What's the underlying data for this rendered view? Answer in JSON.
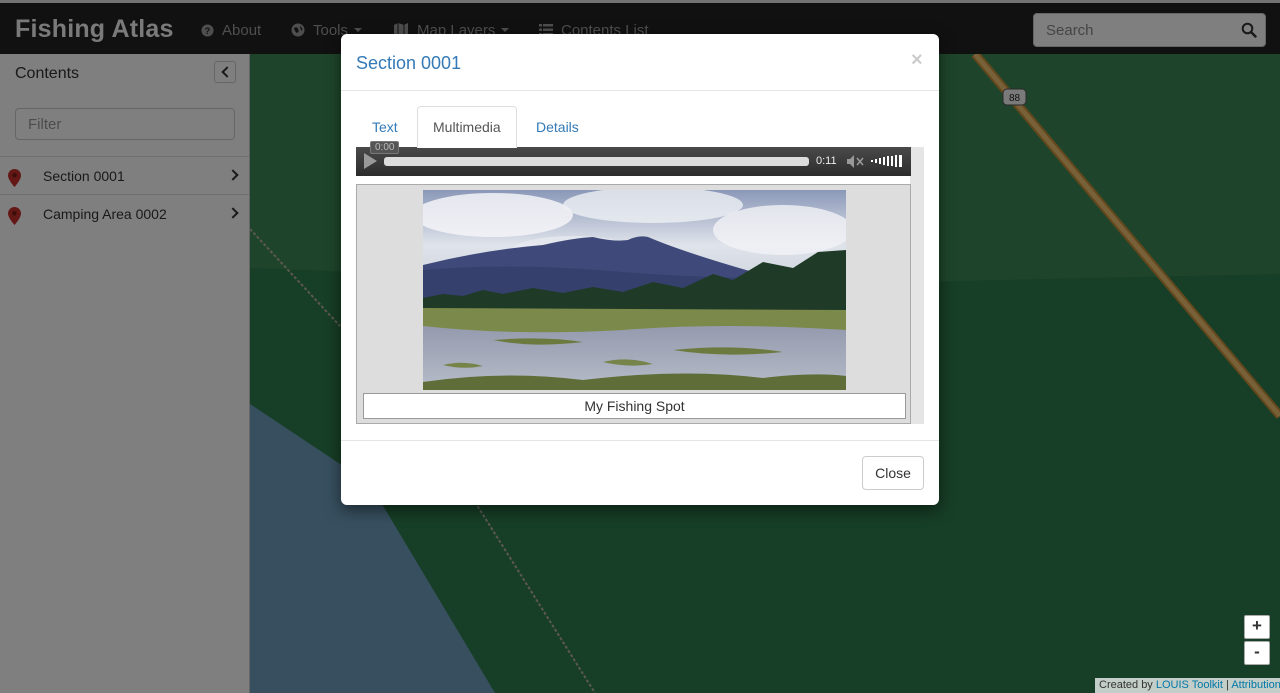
{
  "navbar": {
    "brand": "Fishing Atlas",
    "items": [
      {
        "label": "About",
        "icon": "question-circle-icon"
      },
      {
        "label": "Tools",
        "icon": "globe-icon"
      },
      {
        "label": "Map Layers",
        "icon": "map-icon"
      },
      {
        "label": "Contents List",
        "icon": "list-icon"
      }
    ],
    "search_placeholder": "Search"
  },
  "sidebar": {
    "title": "Contents",
    "filter_placeholder": "Filter",
    "items": [
      {
        "label": "Section 0001"
      },
      {
        "label": "Camping Area 0002"
      }
    ]
  },
  "map": {
    "route_shield": "88",
    "zoom_in": "+",
    "zoom_out": "-",
    "attribution_prefix": "Created by",
    "attribution_link": "LOUIS Toolkit",
    "attribution_sep": "|",
    "attribution_link2": "Attribution"
  },
  "modal": {
    "title": "Section 0001",
    "close_x": "×",
    "tabs": [
      {
        "label": "Text",
        "active": false
      },
      {
        "label": "Multimedia",
        "active": true
      },
      {
        "label": "Details",
        "active": false
      }
    ],
    "player": {
      "current_time": "0:00",
      "duration": "0:11",
      "progress_fraction": 0.0
    },
    "caption": "My Fishing Spot",
    "footer_close": "Close"
  },
  "colors": {
    "navbar_bg": "#222222",
    "link_blue": "#337ab7",
    "map_green": "#2e7b4b",
    "road_orange": "#e0a040",
    "pin_red": "#c9302c"
  }
}
